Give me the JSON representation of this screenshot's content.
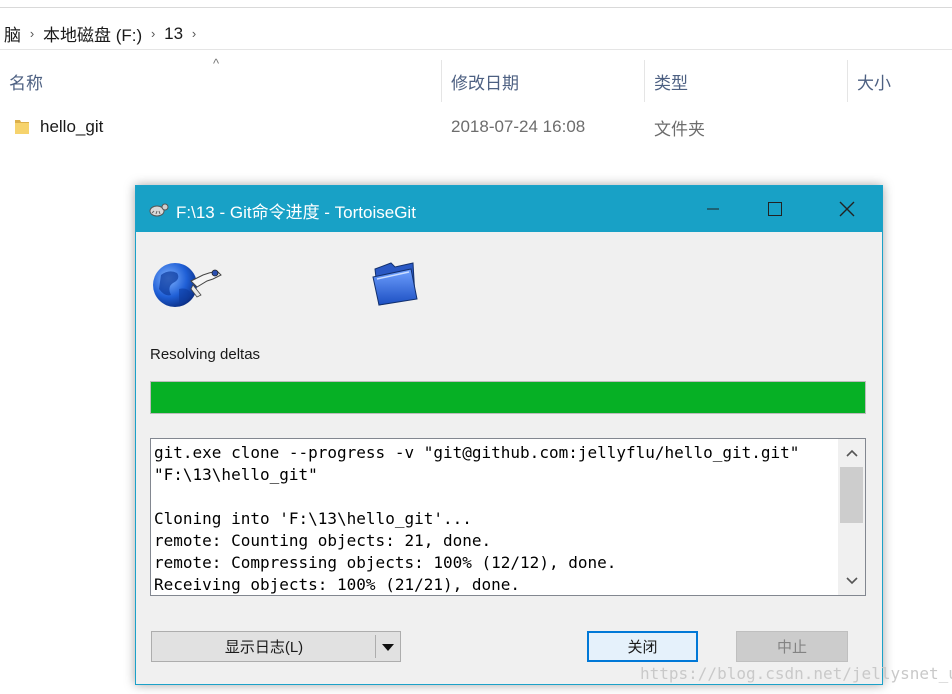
{
  "explorer": {
    "breadcrumb": [
      "脑",
      "本地磁盘 (F:)",
      "13"
    ],
    "columns": {
      "name": "名称",
      "modified": "修改日期",
      "type": "类型",
      "size": "大小"
    },
    "rows": [
      {
        "name": "hello_git",
        "modified": "2018-07-24 16:08",
        "type": "文件夹"
      }
    ]
  },
  "dialog": {
    "title": "F:\\13 - Git命令进度 - TortoiseGit",
    "status_text": "Resolving deltas",
    "progress_fraction": 1.0,
    "log_lines": [
      "git.exe clone --progress -v \"git@github.com:jellyflu/hello_git.git\" \"F:\\13\\hello_git\"",
      "",
      "Cloning into 'F:\\13\\hello_git'...",
      "remote: Counting objects: 21, done.",
      "remote: Compressing objects: 100% (12/12), done.",
      "Receiving objects: 100% (21/21), done."
    ],
    "buttons": {
      "show_log": "显示日志(L)",
      "close": "关闭",
      "abort": "中止"
    },
    "icons": {
      "title": "tortoisegit-icon",
      "globe": "globe-icon",
      "folder": "folder-icon"
    },
    "colors": {
      "titlebar": "#18a1c6",
      "progress": "#06b025",
      "close_border": "#0078d7"
    }
  },
  "watermark": "https://blog.csdn.net/jellysnet_u"
}
